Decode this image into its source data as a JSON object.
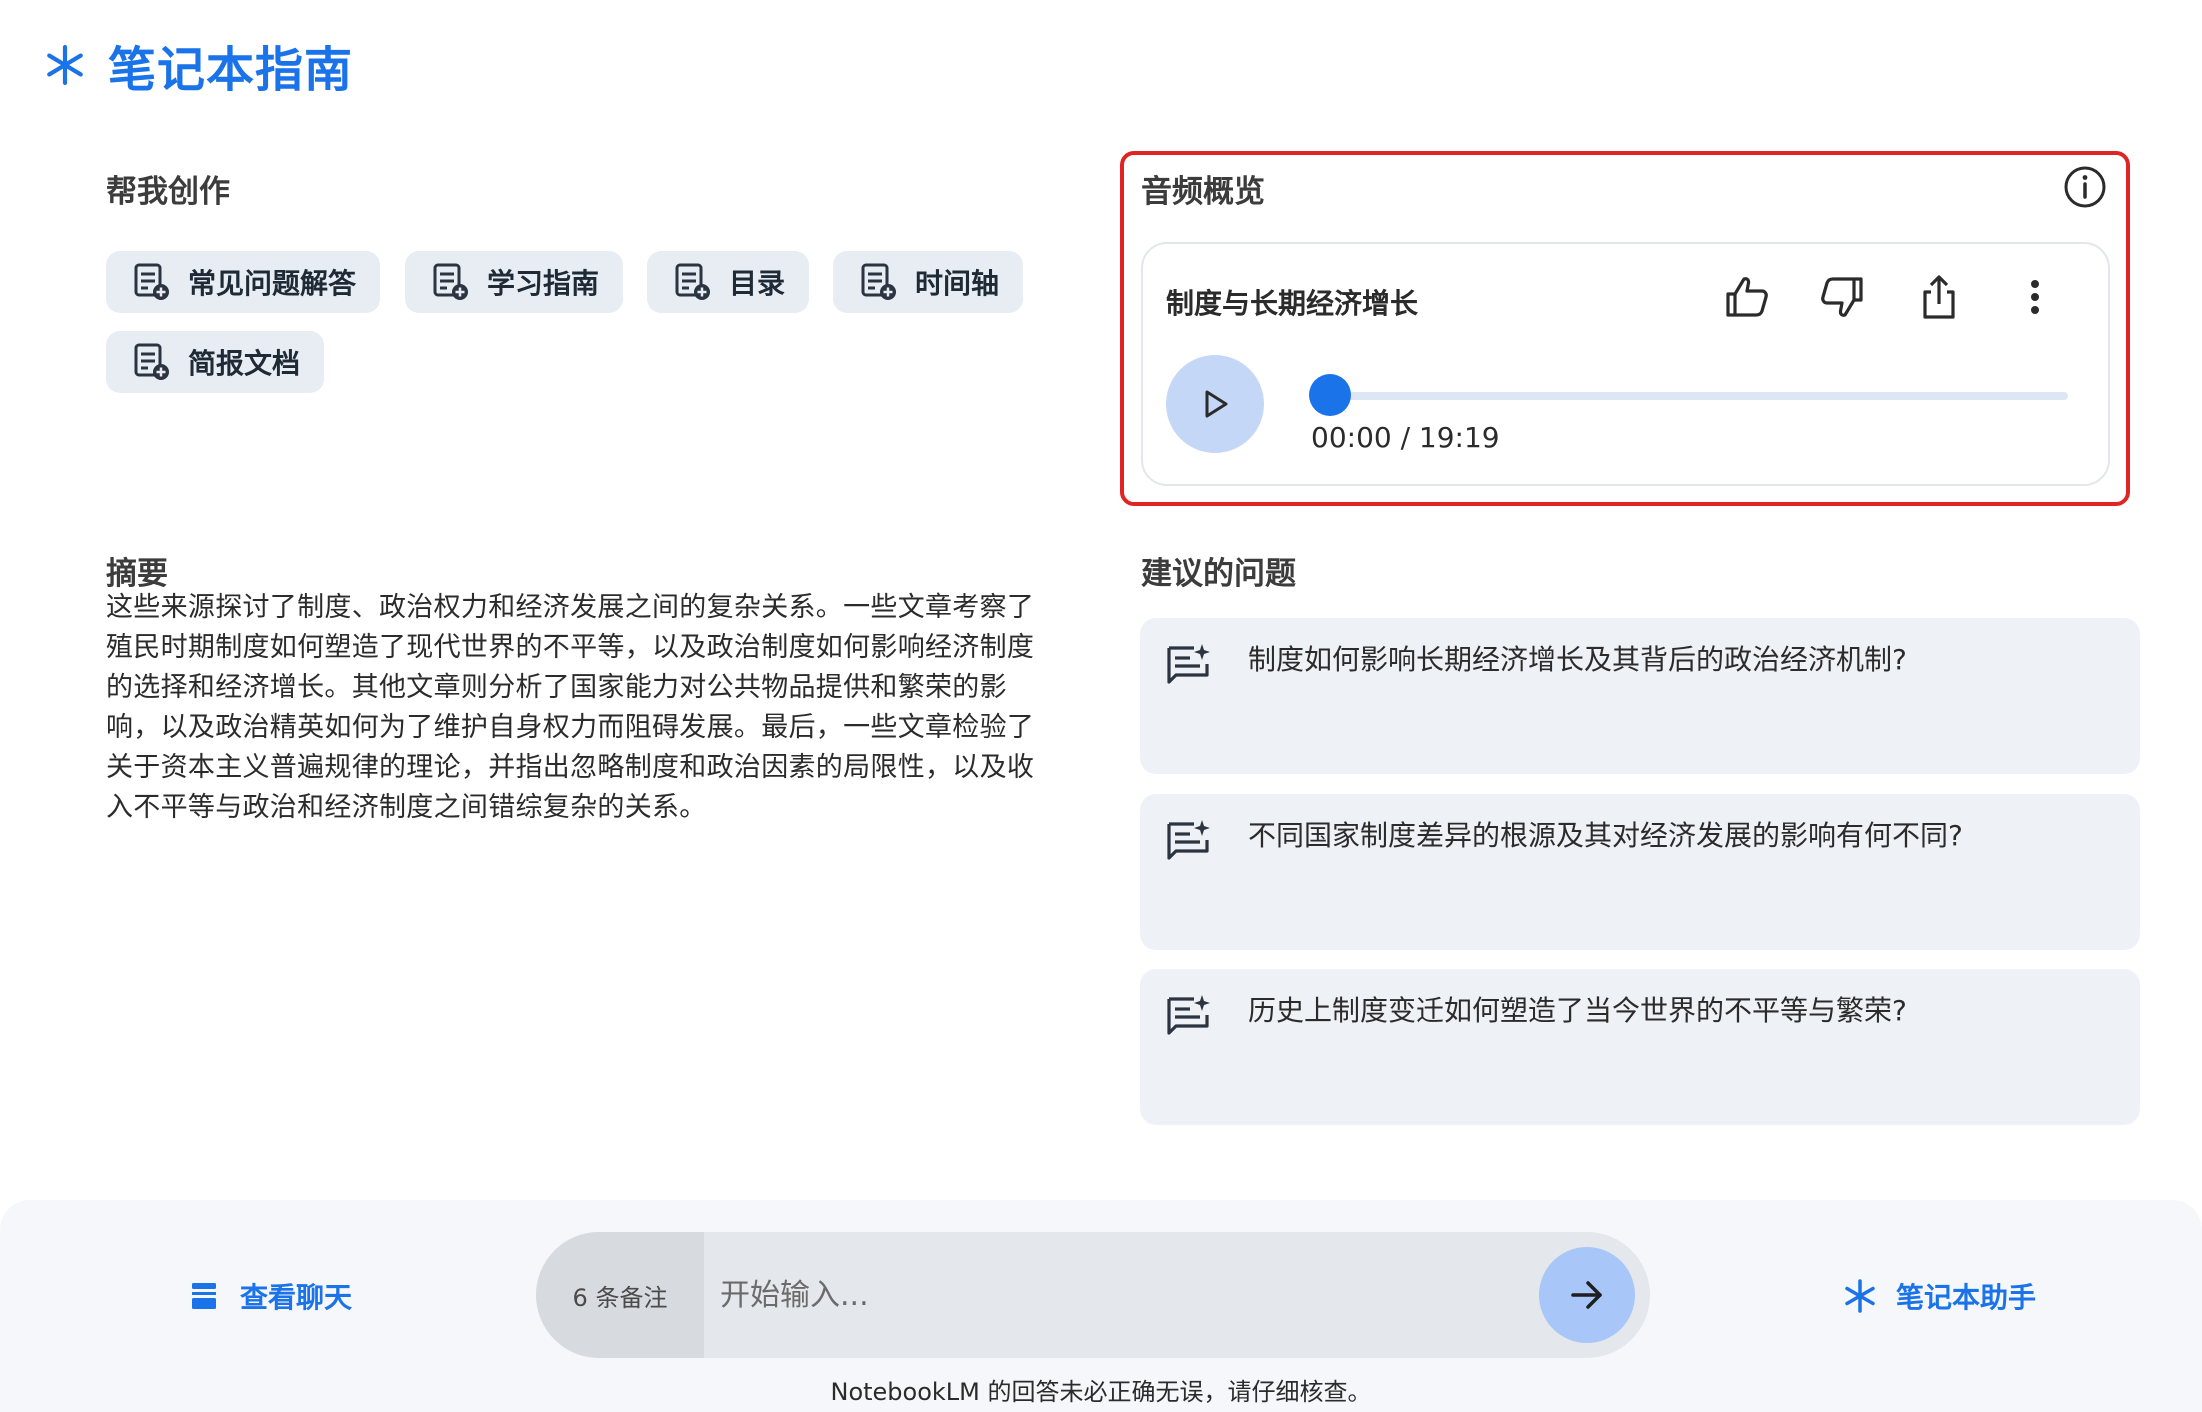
{
  "header": {
    "title": "笔记本指南"
  },
  "create": {
    "title": "帮我创作",
    "chips": [
      {
        "label": "常见问题解答"
      },
      {
        "label": "学习指南"
      },
      {
        "label": "目录"
      },
      {
        "label": "时间轴"
      },
      {
        "label": "简报文档"
      }
    ]
  },
  "summary": {
    "title": "摘要",
    "lines": [
      "这些来源探讨了制度、政治权力和经济发展之间的复杂关系。一些文章考察了",
      "殖民时期制度如何塑造了现代世界的不平等，以及政治制度如何影响经济制度",
      "的选择和经济增长。其他文章则分析了国家能力对公共物品提供和繁荣的影",
      "响，以及政治精英如何为了维护自身权力而阻碍发展。最后，一些文章检验了",
      "关于资本主义普遍规律的理论，并指出忽略制度和政治因素的局限性，以及收",
      "入不平等与政治和经济制度之间错综复杂的关系。"
    ]
  },
  "audio": {
    "title": "音频概览",
    "episode_title": "制度与长期经济增长",
    "time": "00:00 / 19:19",
    "progress": 0,
    "icons": [
      "info-icon",
      "thumbs-up-icon",
      "thumbs-down-icon",
      "share-icon",
      "more-vert-icon",
      "play-icon"
    ]
  },
  "questions": {
    "title": "建议的问题",
    "items": [
      {
        "text": "制度如何影响长期经济增长及其背后的政治经济机制?"
      },
      {
        "text": "不同国家制度差异的根源及其对经济发展的影响有何不同?"
      },
      {
        "text": "历史上制度变迁如何塑造了当今世界的不平等与繁荣?"
      }
    ]
  },
  "bottom": {
    "view_chat": "查看聊天",
    "notes_count": "6 条备注",
    "input_placeholder": "开始输入...",
    "assistant": "笔记本助手",
    "disclaimer": "NotebookLM 的回答未必正确无误，请仔细核查。"
  },
  "colors": {
    "accent": "#1a73e8",
    "highlight": "#e02424",
    "card": "#eef1f5"
  }
}
